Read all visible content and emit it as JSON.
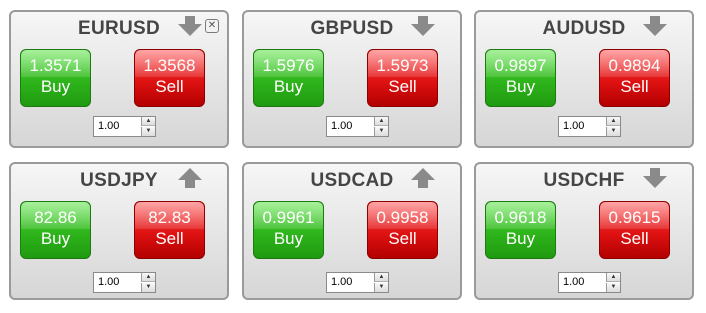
{
  "panels": [
    {
      "pair": "EURUSD",
      "direction": "down",
      "buy_price": "1.3571",
      "sell_price": "1.3568",
      "buy_label": "Buy",
      "sell_label": "Sell",
      "quantity": "1.00",
      "has_close": true
    },
    {
      "pair": "GBPUSD",
      "direction": "down",
      "buy_price": "1.5976",
      "sell_price": "1.5973",
      "buy_label": "Buy",
      "sell_label": "Sell",
      "quantity": "1.00",
      "has_close": false
    },
    {
      "pair": "AUDUSD",
      "direction": "down",
      "buy_price": "0.9897",
      "sell_price": "0.9894",
      "buy_label": "Buy",
      "sell_label": "Sell",
      "quantity": "1.00",
      "has_close": false
    },
    {
      "pair": "USDJPY",
      "direction": "up",
      "buy_price": "82.86",
      "sell_price": "82.83",
      "buy_label": "Buy",
      "sell_label": "Sell",
      "quantity": "1.00",
      "has_close": false
    },
    {
      "pair": "USDCAD",
      "direction": "up",
      "buy_price": "0.9961",
      "sell_price": "0.9958",
      "buy_label": "Buy",
      "sell_label": "Sell",
      "quantity": "1.00",
      "has_close": false
    },
    {
      "pair": "USDCHF",
      "direction": "down",
      "buy_price": "0.9618",
      "sell_price": "0.9615",
      "buy_label": "Buy",
      "sell_label": "Sell",
      "quantity": "1.00",
      "has_close": false
    }
  ],
  "icons": {
    "close": "close-icon",
    "up": "arrow-up-icon",
    "down": "arrow-down-icon"
  },
  "colors": {
    "buy": "#2fb51c",
    "sell": "#e01212",
    "title": "#454545",
    "arrow": "#8a8a8a"
  }
}
